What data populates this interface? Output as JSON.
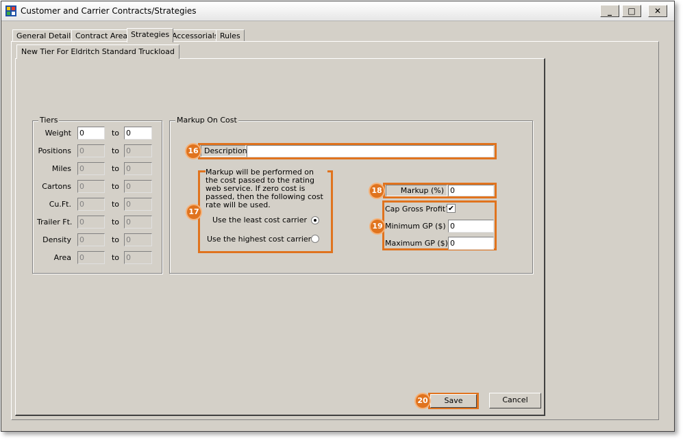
{
  "window": {
    "title": "Customer and Carrier Contracts/Strategies",
    "minimize": "_",
    "maximize": "□",
    "close": "✕"
  },
  "tabs": [
    "General Details",
    "Contract Areas",
    "Strategies",
    "Accessorials",
    "Rules"
  ],
  "subtab": "New Tier For Eldritch Standard Truckload",
  "tiers": {
    "legend": "Tiers",
    "to_label": "to",
    "rows": [
      {
        "label": "Weight",
        "from": "0",
        "to": "0"
      },
      {
        "label": "Positions",
        "from": "0",
        "to": "0"
      },
      {
        "label": "Miles",
        "from": "0",
        "to": "0"
      },
      {
        "label": "Cartons",
        "from": "0",
        "to": "0"
      },
      {
        "label": "Cu.Ft.",
        "from": "0",
        "to": "0"
      },
      {
        "label": "Trailer Ft.",
        "from": "0",
        "to": "0"
      },
      {
        "label": "Density",
        "from": "0",
        "to": "0"
      },
      {
        "label": "Area",
        "from": "0",
        "to": "0"
      }
    ]
  },
  "markup": {
    "legend": "Markup On Cost",
    "description_label": "Description",
    "description_value": "",
    "info_text": "Markup will be performed on the cost passed to the rating web service. If zero cost is passed, then the following cost rate will be used.",
    "option_least": "Use the least cost carrier",
    "option_highest": "Use the highest cost carrier",
    "markup_pct_label": "Markup (%)",
    "markup_pct_value": "0",
    "cap_label": "Cap Gross Profit?",
    "cap_checked": "✔",
    "min_gp_label": "Minimum GP ($)",
    "min_gp_value": "0",
    "max_gp_label": "Maximum GP ($)",
    "max_gp_value": "0"
  },
  "badges": {
    "b16": "16",
    "b17": "17",
    "b18": "18",
    "b19": "19",
    "b20": "20"
  },
  "buttons": {
    "save": "Save",
    "cancel": "Cancel"
  },
  "colors": {
    "callout": "#e0731e",
    "window_bg": "#d4d0c8"
  }
}
